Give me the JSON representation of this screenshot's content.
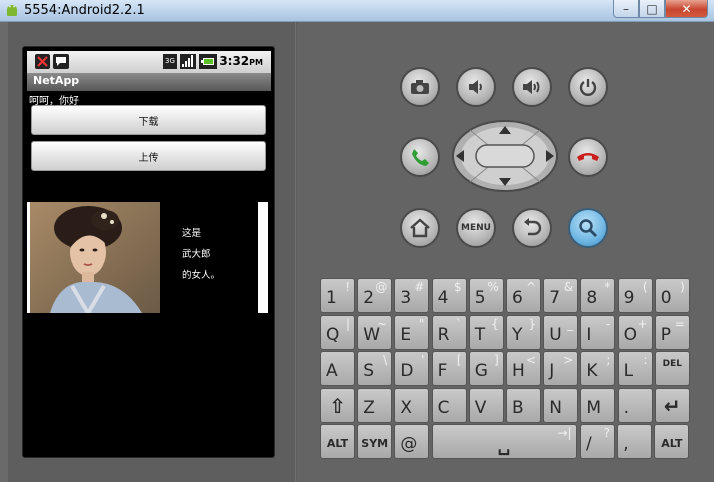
{
  "window": {
    "title": "5554:Android2.2.1",
    "minimize": "–",
    "maximize": "□",
    "close": "✕"
  },
  "statusbar": {
    "time": "3:32",
    "time_suffix": "PM",
    "network": "3G"
  },
  "app": {
    "title": "NetApp",
    "greeting": "呵呵，你好",
    "download_label": "下载",
    "upload_label": "上传",
    "caption_lines": [
      "这是",
      "武大郎",
      "的女人。"
    ]
  },
  "controls": {
    "menu_label": "MENU",
    "icons": [
      "camera-icon",
      "volume-down-icon",
      "volume-up-icon",
      "power-icon",
      "call-icon",
      "end-call-icon",
      "home-icon",
      "back-icon",
      "search-icon"
    ],
    "search_color": "#6fb7e3"
  },
  "keyboard": {
    "row1": [
      {
        "main": "1",
        "alt": "!"
      },
      {
        "main": "2",
        "alt": "@"
      },
      {
        "main": "3",
        "alt": "#"
      },
      {
        "main": "4",
        "alt": "$"
      },
      {
        "main": "5",
        "alt": "%"
      },
      {
        "main": "6",
        "alt": "^"
      },
      {
        "main": "7",
        "alt": "&"
      },
      {
        "main": "8",
        "alt": "*"
      },
      {
        "main": "9",
        "alt": "("
      },
      {
        "main": "0",
        "alt": ")"
      }
    ],
    "row2": [
      {
        "main": "Q",
        "alt": "|"
      },
      {
        "main": "W",
        "alt": "~"
      },
      {
        "main": "E",
        "alt": "\""
      },
      {
        "main": "R",
        "alt": "`"
      },
      {
        "main": "T",
        "alt": "{"
      },
      {
        "main": "Y",
        "alt": "}"
      },
      {
        "main": "U",
        "alt": "_"
      },
      {
        "main": "I",
        "alt": "-"
      },
      {
        "main": "O",
        "alt": "+"
      },
      {
        "main": "P",
        "alt": "="
      }
    ],
    "row3": [
      {
        "main": "A",
        "alt": ""
      },
      {
        "main": "S",
        "alt": "\\"
      },
      {
        "main": "D",
        "alt": "'"
      },
      {
        "main": "F",
        "alt": "["
      },
      {
        "main": "G",
        "alt": "]"
      },
      {
        "main": "H",
        "alt": "<"
      },
      {
        "main": "J",
        "alt": ">"
      },
      {
        "main": "K",
        "alt": ";"
      },
      {
        "main": "L",
        "alt": ":"
      },
      {
        "main": "DEL",
        "alt": ""
      }
    ],
    "row4": [
      {
        "main": "⇧",
        "alt": ""
      },
      {
        "main": "Z",
        "alt": ""
      },
      {
        "main": "X",
        "alt": ""
      },
      {
        "main": "C",
        "alt": ""
      },
      {
        "main": "V",
        "alt": ""
      },
      {
        "main": "B",
        "alt": ""
      },
      {
        "main": "N",
        "alt": ""
      },
      {
        "main": "M",
        "alt": ""
      },
      {
        "main": ".",
        "alt": ""
      },
      {
        "main": "↵",
        "alt": ""
      }
    ],
    "row5": [
      {
        "main": "ALT",
        "alt": ""
      },
      {
        "main": "SYM",
        "alt": ""
      },
      {
        "main": "@",
        "alt": ""
      },
      {
        "main": "␣",
        "alt": "→|"
      },
      {
        "main": "/",
        "alt": "?"
      },
      {
        "main": ",",
        "alt": ""
      },
      {
        "main": "ALT",
        "alt": ""
      }
    ]
  }
}
